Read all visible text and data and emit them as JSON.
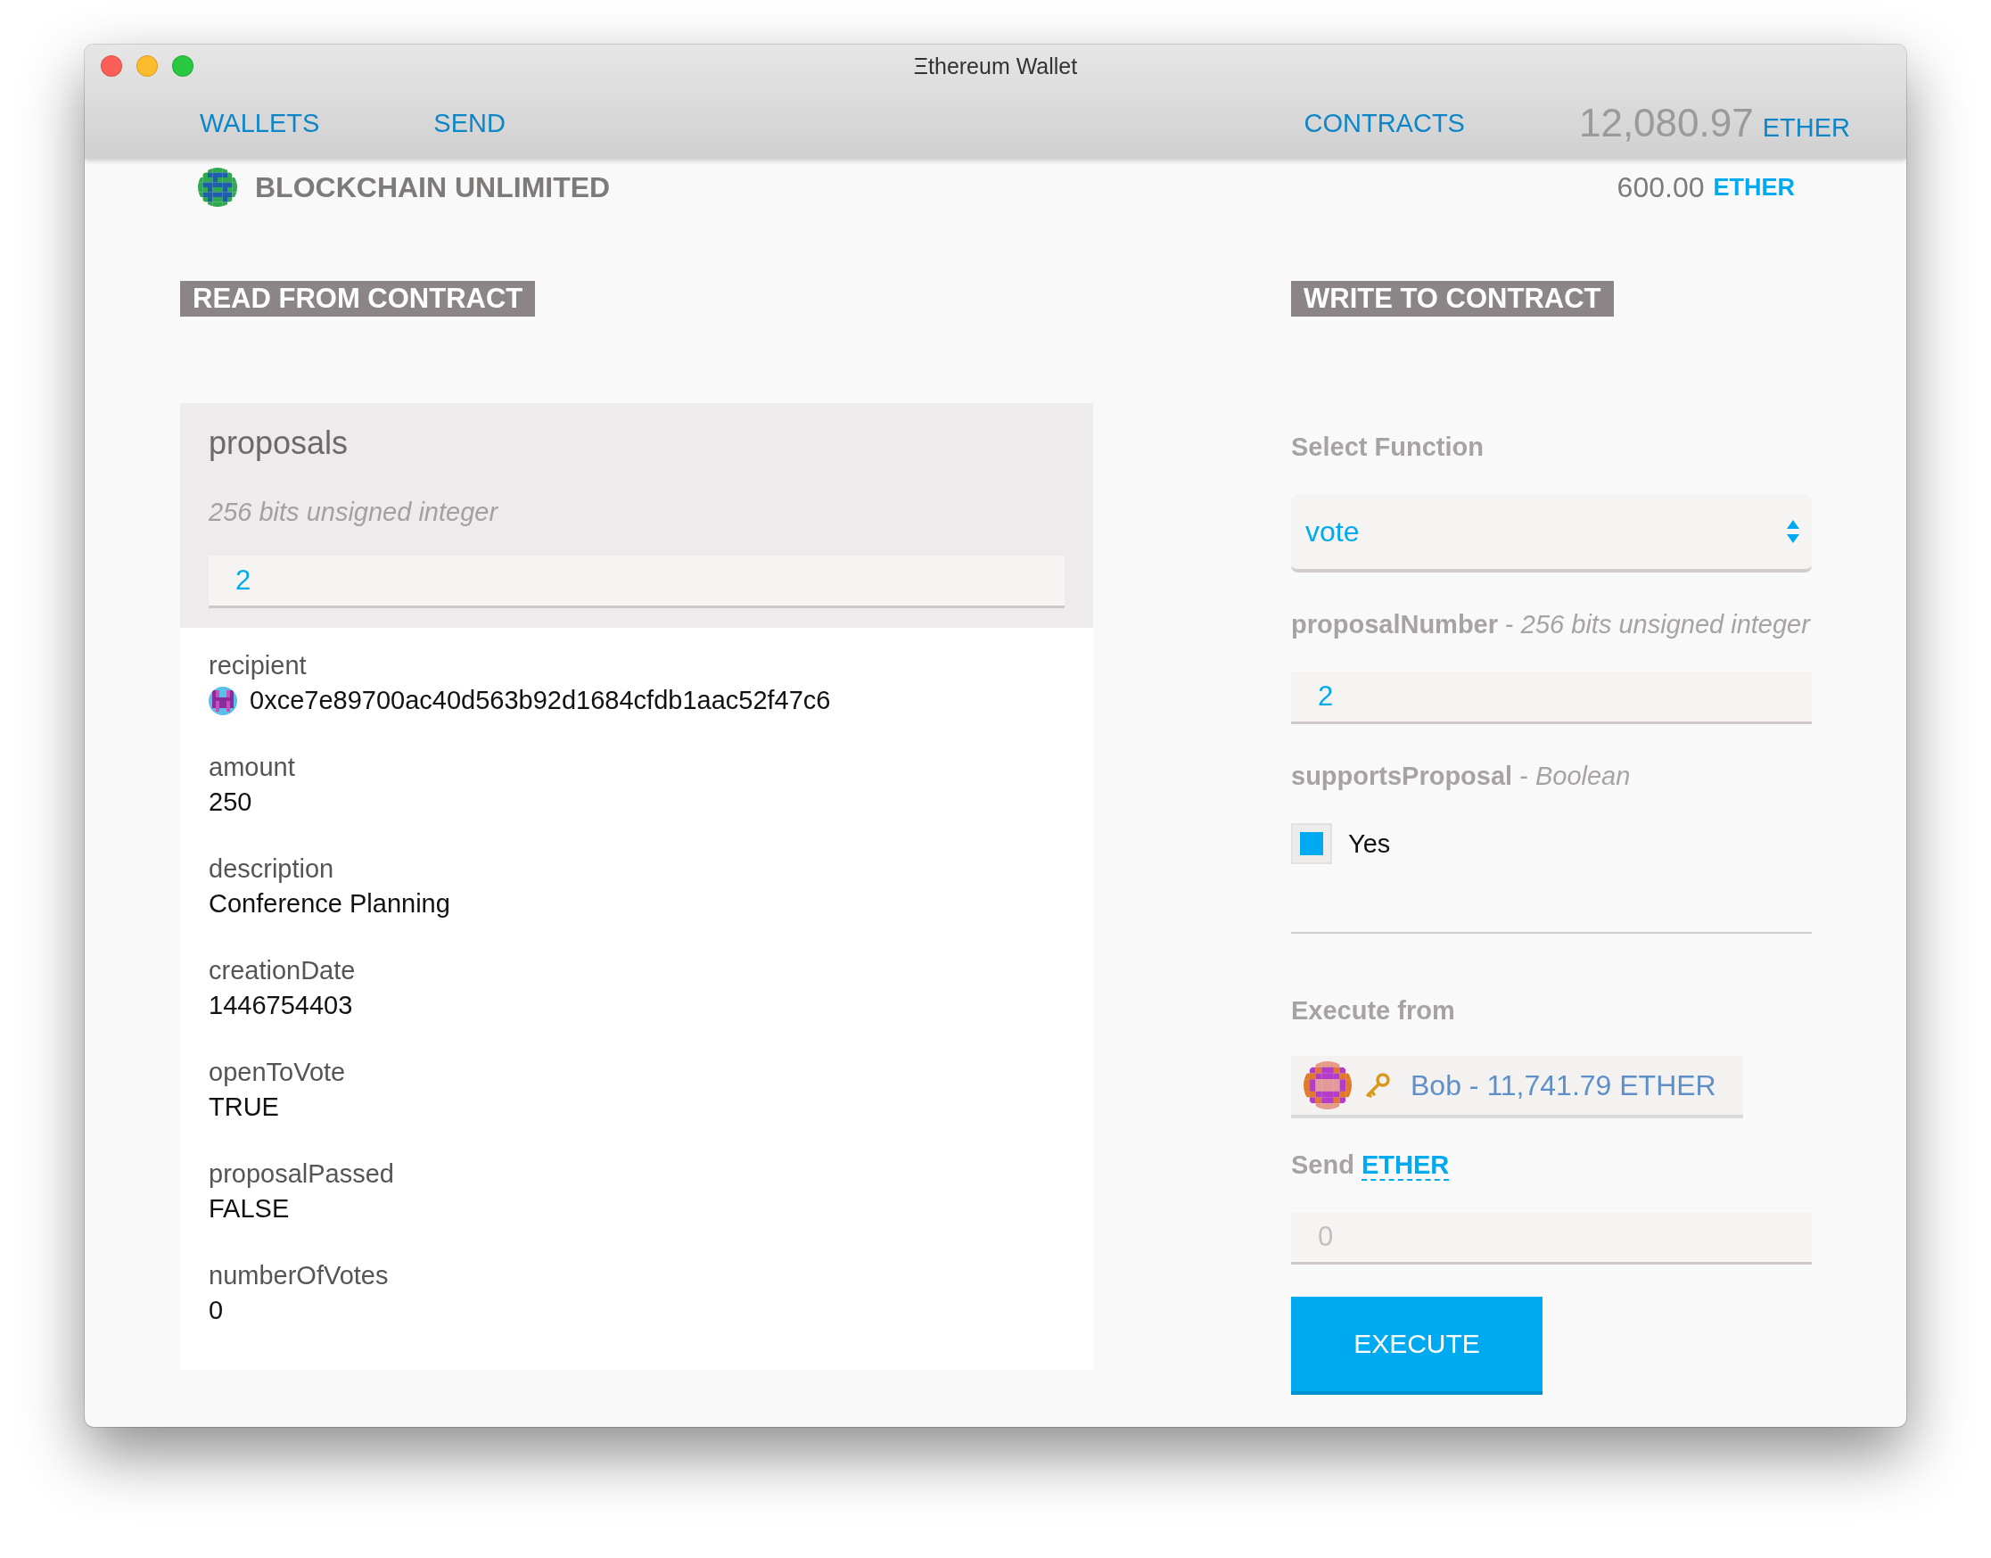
{
  "window": {
    "title": "Ξthereum Wallet"
  },
  "nav": {
    "items": [
      {
        "label": "WALLETS"
      },
      {
        "label": "SEND"
      },
      {
        "label": "CONTRACTS"
      }
    ],
    "balance": {
      "amount": "12,080.97",
      "unit": "ETHER"
    }
  },
  "contract": {
    "name": "BLOCKCHAIN UNLIMITED",
    "balance": "600.00",
    "unit": "ETHER"
  },
  "read_section": {
    "title": "READ FROM CONTRACT",
    "function": {
      "name": "proposals",
      "type": "256 bits unsigned integer",
      "value": "2"
    },
    "outputs": [
      {
        "label": "recipient",
        "value": "0xce7e89700ac40d563b92d1684cfdb1aac52f47c6",
        "kind": "address"
      },
      {
        "label": "amount",
        "value": "250",
        "kind": "text"
      },
      {
        "label": "description",
        "value": "Conference Planning",
        "kind": "text"
      },
      {
        "label": "creationDate",
        "value": "1446754403",
        "kind": "text"
      },
      {
        "label": "openToVote",
        "value": "TRUE",
        "kind": "text"
      },
      {
        "label": "proposalPassed",
        "value": "FALSE",
        "kind": "text"
      },
      {
        "label": "numberOfVotes",
        "value": "0",
        "kind": "text"
      }
    ]
  },
  "write_section": {
    "title": "WRITE TO CONTRACT",
    "select_label": "Select Function",
    "selected_function": "vote",
    "params": [
      {
        "label": "**proposalNumber** - *256 bits unsigned integer*",
        "kind": "input",
        "value": "2"
      },
      {
        "label": "**supportsProposal** - *Boolean*",
        "kind": "checkbox",
        "checked": true,
        "checkbox_label": "Yes"
      }
    ],
    "execute_from_label": "Execute from",
    "account": "Bob - 11,741.79 ETHER",
    "send_label": "Send",
    "send_unit": "ETHER",
    "send_placeholder": "0",
    "button": "EXECUTE"
  }
}
